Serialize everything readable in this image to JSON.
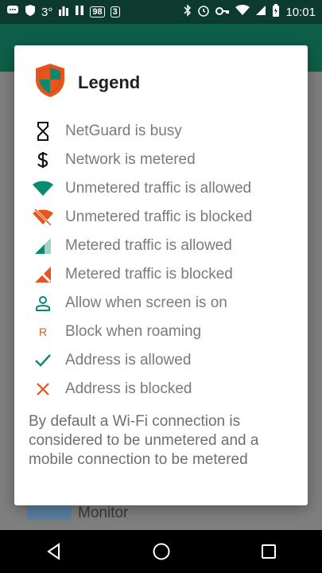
{
  "status_bar": {
    "temperature": "3°",
    "badge1": "98",
    "badge2": "3",
    "time": "10:01"
  },
  "background": {
    "monitor_text": "Monitor"
  },
  "dialog": {
    "title": "Legend",
    "items": [
      {
        "icon": "hourglass-icon",
        "label": "NetGuard is busy"
      },
      {
        "icon": "dollar-icon",
        "label": "Network is metered"
      },
      {
        "icon": "wifi-allowed-icon",
        "label": "Unmetered traffic is allowed"
      },
      {
        "icon": "wifi-blocked-icon",
        "label": "Unmetered traffic is blocked"
      },
      {
        "icon": "cellular-allowed-icon",
        "label": "Metered traffic is allowed"
      },
      {
        "icon": "cellular-blocked-icon",
        "label": "Metered traffic is blocked"
      },
      {
        "icon": "person-icon",
        "label": "Allow when screen is on"
      },
      {
        "icon": "roaming-r-icon",
        "label": "Block when roaming"
      },
      {
        "icon": "check-icon",
        "label": "Address is allowed"
      },
      {
        "icon": "cross-icon",
        "label": "Address is blocked"
      }
    ],
    "roaming_letter": "R",
    "note": "By default a Wi-Fi connection is considered to be unmetered and a mobile connection to be metered"
  },
  "colors": {
    "teal": "#0b8a72",
    "orange": "#e6561c",
    "statusbar": "#0c3a2c",
    "appbar": "#0e5f49"
  }
}
